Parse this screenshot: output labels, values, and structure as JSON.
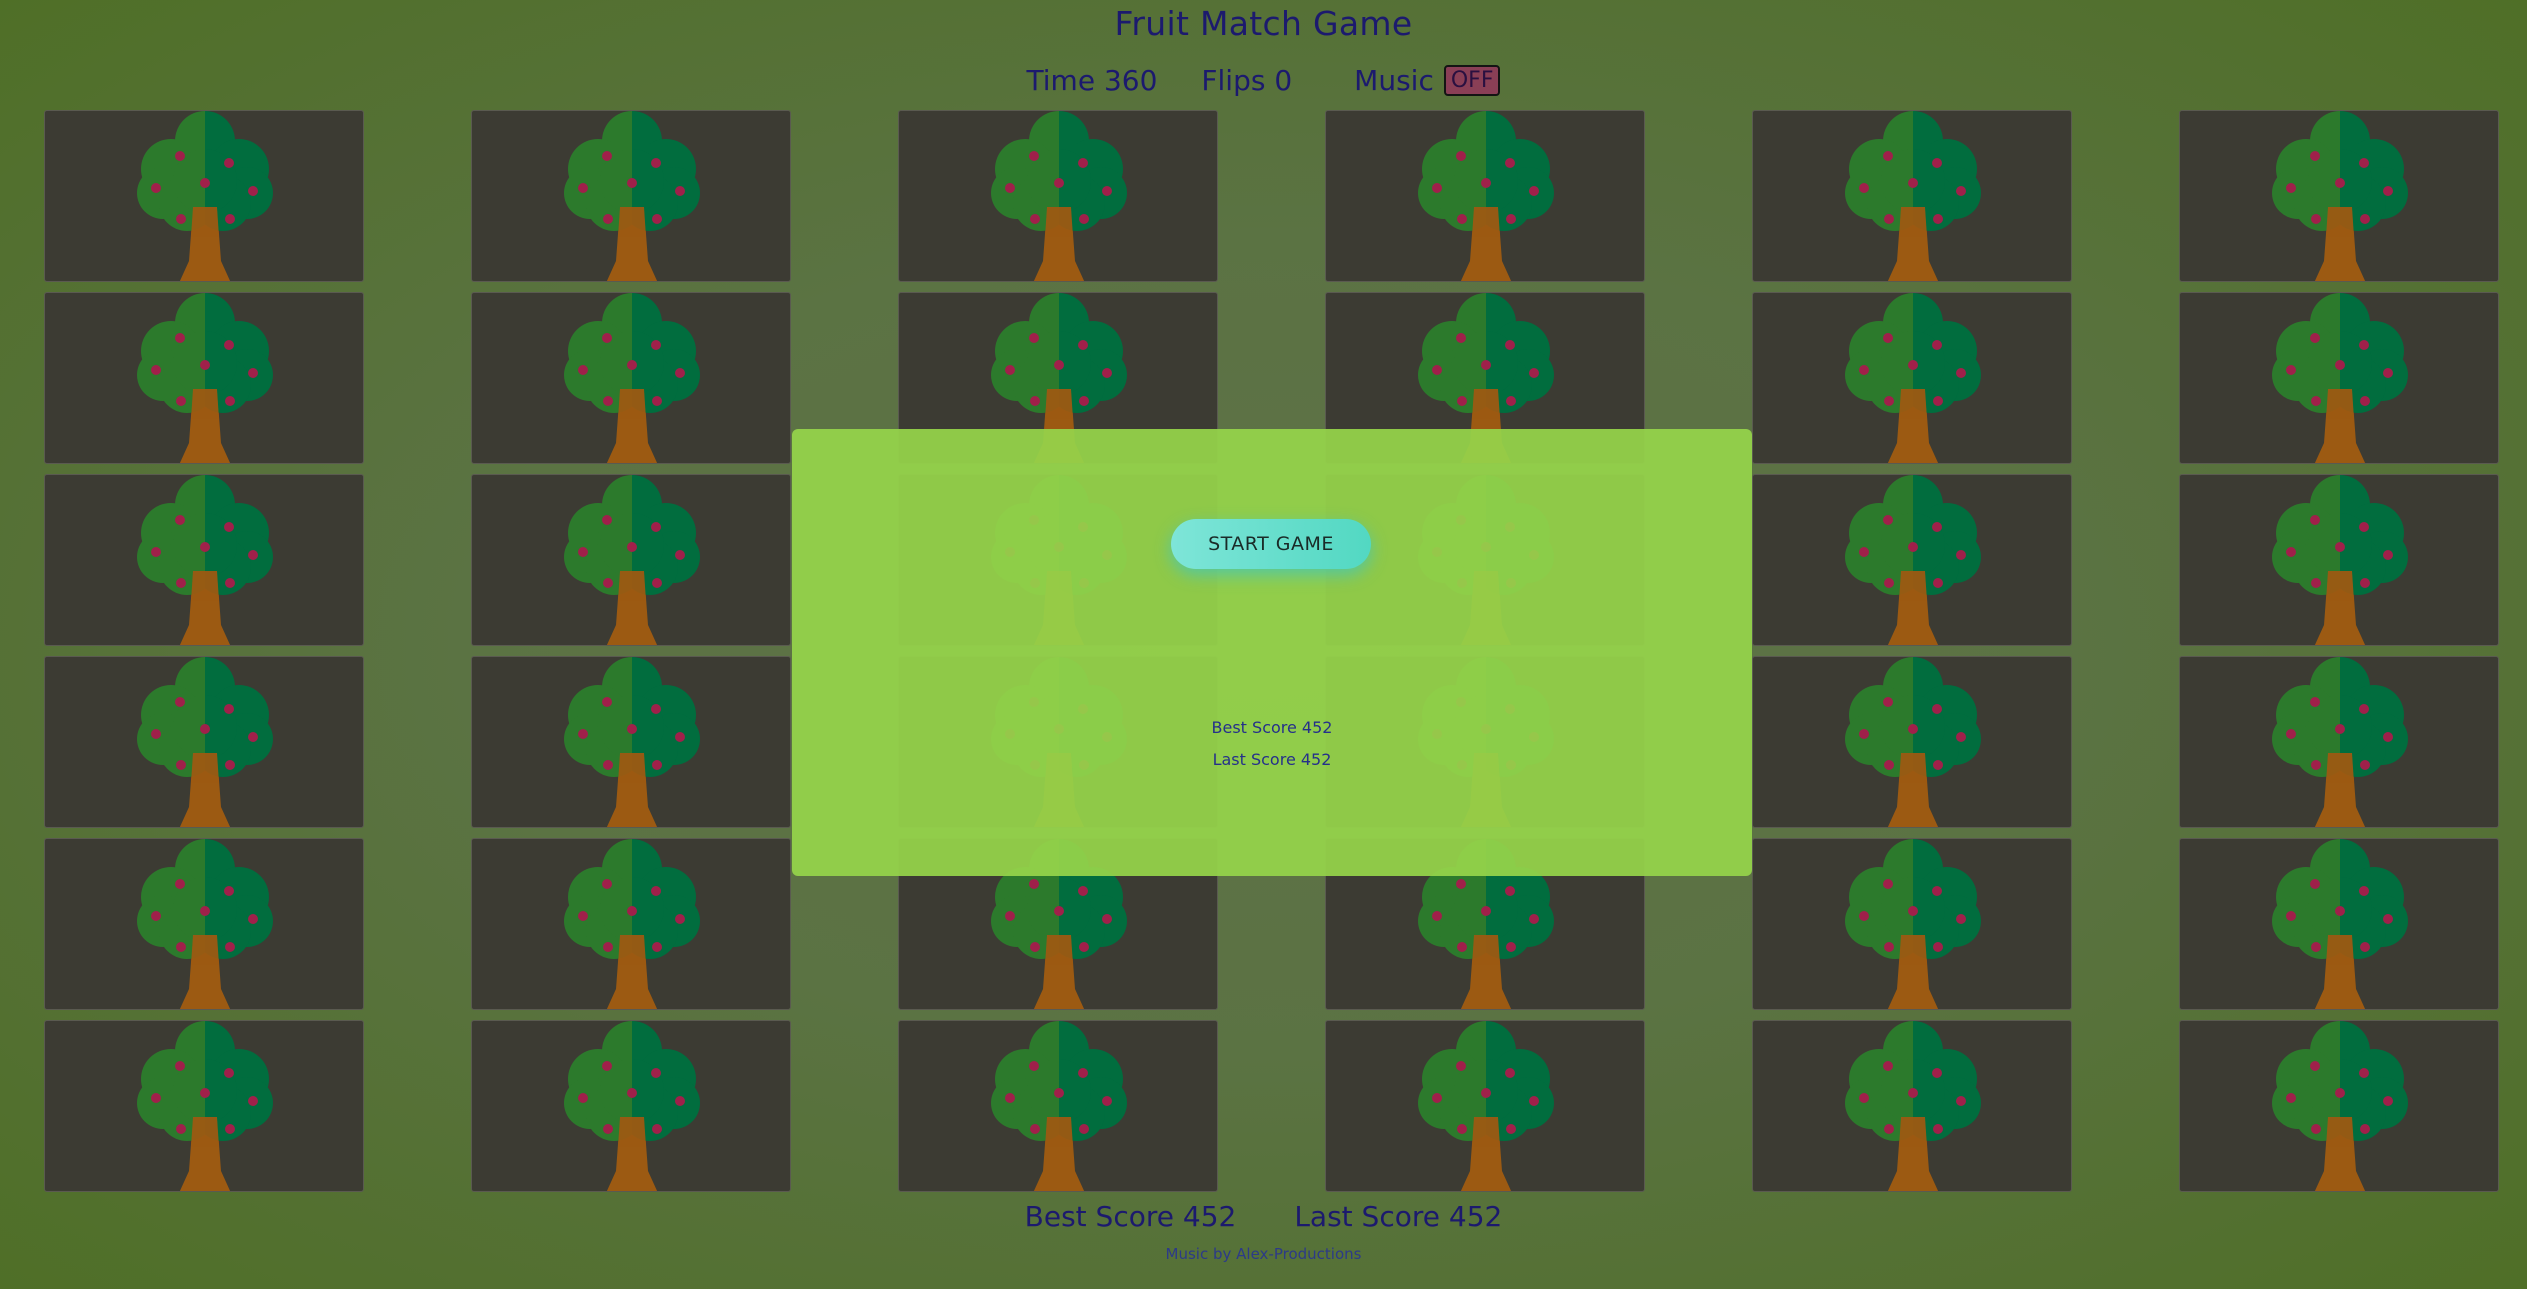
{
  "title": "Fruit Match Game",
  "stats": {
    "time_label": "Time",
    "time_value": "360",
    "flips_label": "Flips",
    "flips_value": "0",
    "music_label": "Music",
    "music_state": "OFF"
  },
  "board": {
    "rows": 6,
    "cols": 6,
    "card_back_icon": "tree-icon"
  },
  "overlay": {
    "start_label": "START GAME",
    "best_score": "Best Score 452",
    "last_score": "Last Score 452"
  },
  "footer": {
    "best_score": "Best Score 452",
    "last_score": "Last Score 452",
    "credit": "Music by Alex-Productions"
  },
  "colors": {
    "background": "#5b7343",
    "card": "#3c3b33",
    "overlay": "#96d44a",
    "title_text": "#1c1a6e",
    "start_button": "#5fdcc9",
    "music_off": "#8a3f56"
  }
}
